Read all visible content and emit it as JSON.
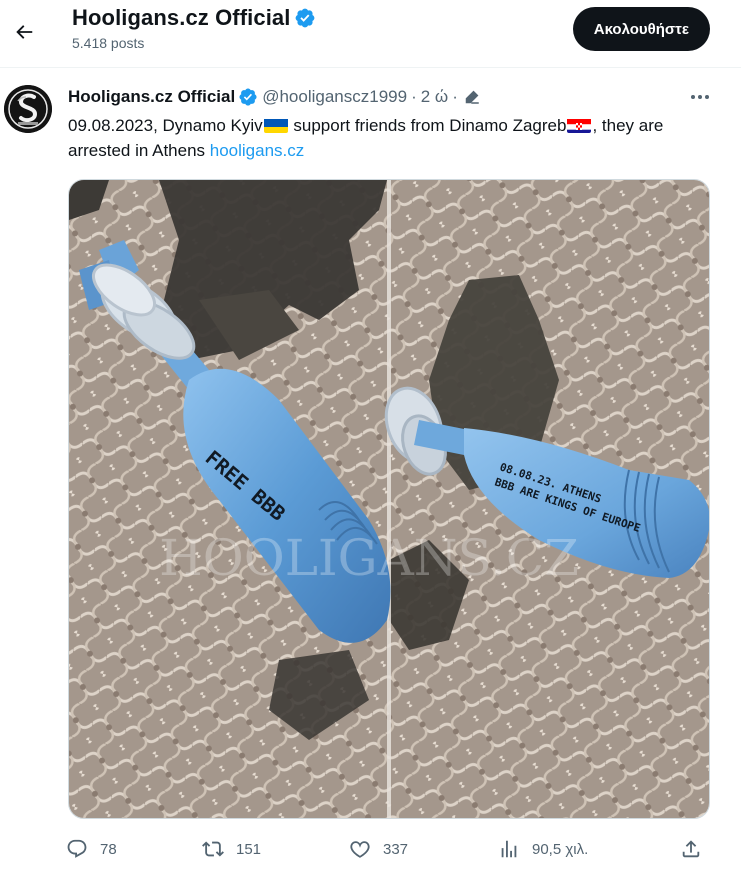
{
  "header": {
    "title": "Hooligans.cz Official",
    "posts_count": "5.418 posts",
    "follow_label": "Ακολουθήστε"
  },
  "tweet": {
    "author_name": "Hooligans.cz Official",
    "author_handle": "@hooliganscz1999",
    "separator": "·",
    "time": "2 ώ",
    "text_part1": "09.08.2023, Dynamo Kyiv",
    "text_part2": " support friends from Dinamo Zagreb",
    "text_part3": ", they are arrested in Athens ",
    "link_text": "hooligans.cz",
    "flags": [
      "ukraine-flag",
      "croatia-flag"
    ]
  },
  "media": {
    "left_writing": [
      "FREE BBB"
    ],
    "right_writing": [
      "08.08.23. ATHENS",
      "BBB ARE KINGS OF EUROPE"
    ],
    "watermark": "HOOLIGANS.CZ"
  },
  "actions": {
    "replies": "78",
    "reposts": "151",
    "likes": "337",
    "views": "90,5 χιλ."
  },
  "colors": {
    "accent": "#1d9bf0",
    "text": "#0f1419",
    "muted": "#536471",
    "verified": "#1d9bf0",
    "shell": "#5b9bd5"
  },
  "icons": [
    "back-arrow-icon",
    "verified-badge-icon",
    "edit-pencil-icon",
    "more-dots-icon",
    "reply-icon",
    "repost-icon",
    "like-icon",
    "views-icon",
    "share-icon"
  ]
}
